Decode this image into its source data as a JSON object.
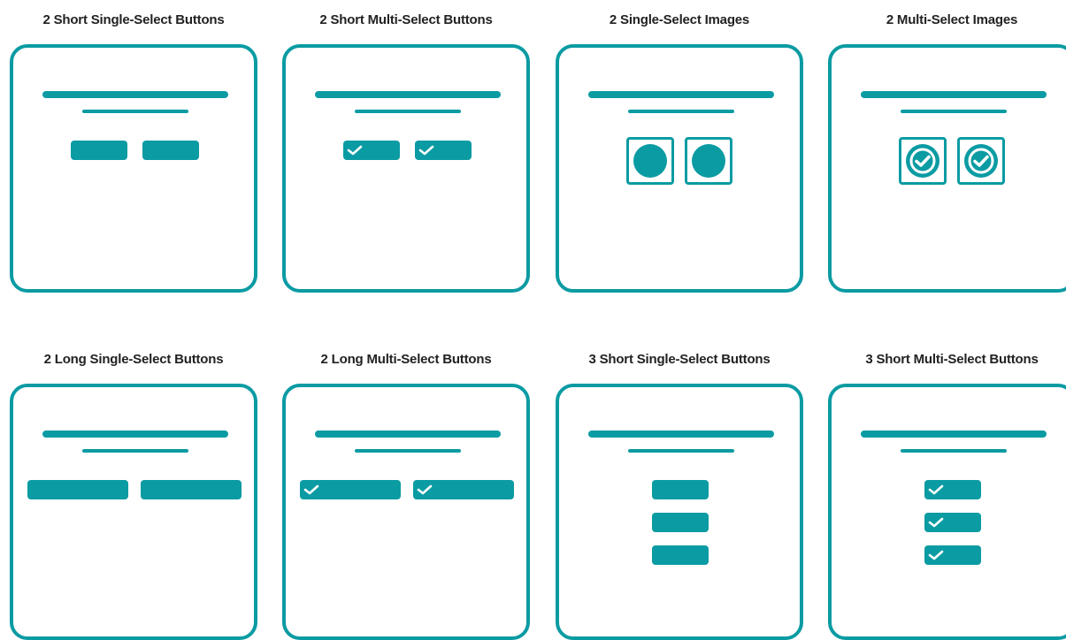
{
  "colors": {
    "accent": "#0b9ba3",
    "title_text": "#222222",
    "background": "#ffffff"
  },
  "tiles": [
    {
      "title": "2 Short Single-Select Buttons"
    },
    {
      "title": "2 Short Multi-Select Buttons"
    },
    {
      "title": "2 Single-Select Images"
    },
    {
      "title": "2 Multi-Select Images"
    },
    {
      "title": "2 Long Single-Select Buttons"
    },
    {
      "title": "2 Long Multi-Select Buttons"
    },
    {
      "title": "3 Short Single-Select Buttons"
    },
    {
      "title": "3 Short Multi-Select Buttons"
    }
  ],
  "icons": {
    "check": "checkmark-icon",
    "check_circle": "check-circle-icon",
    "image_placeholder": "circle-image-icon"
  }
}
